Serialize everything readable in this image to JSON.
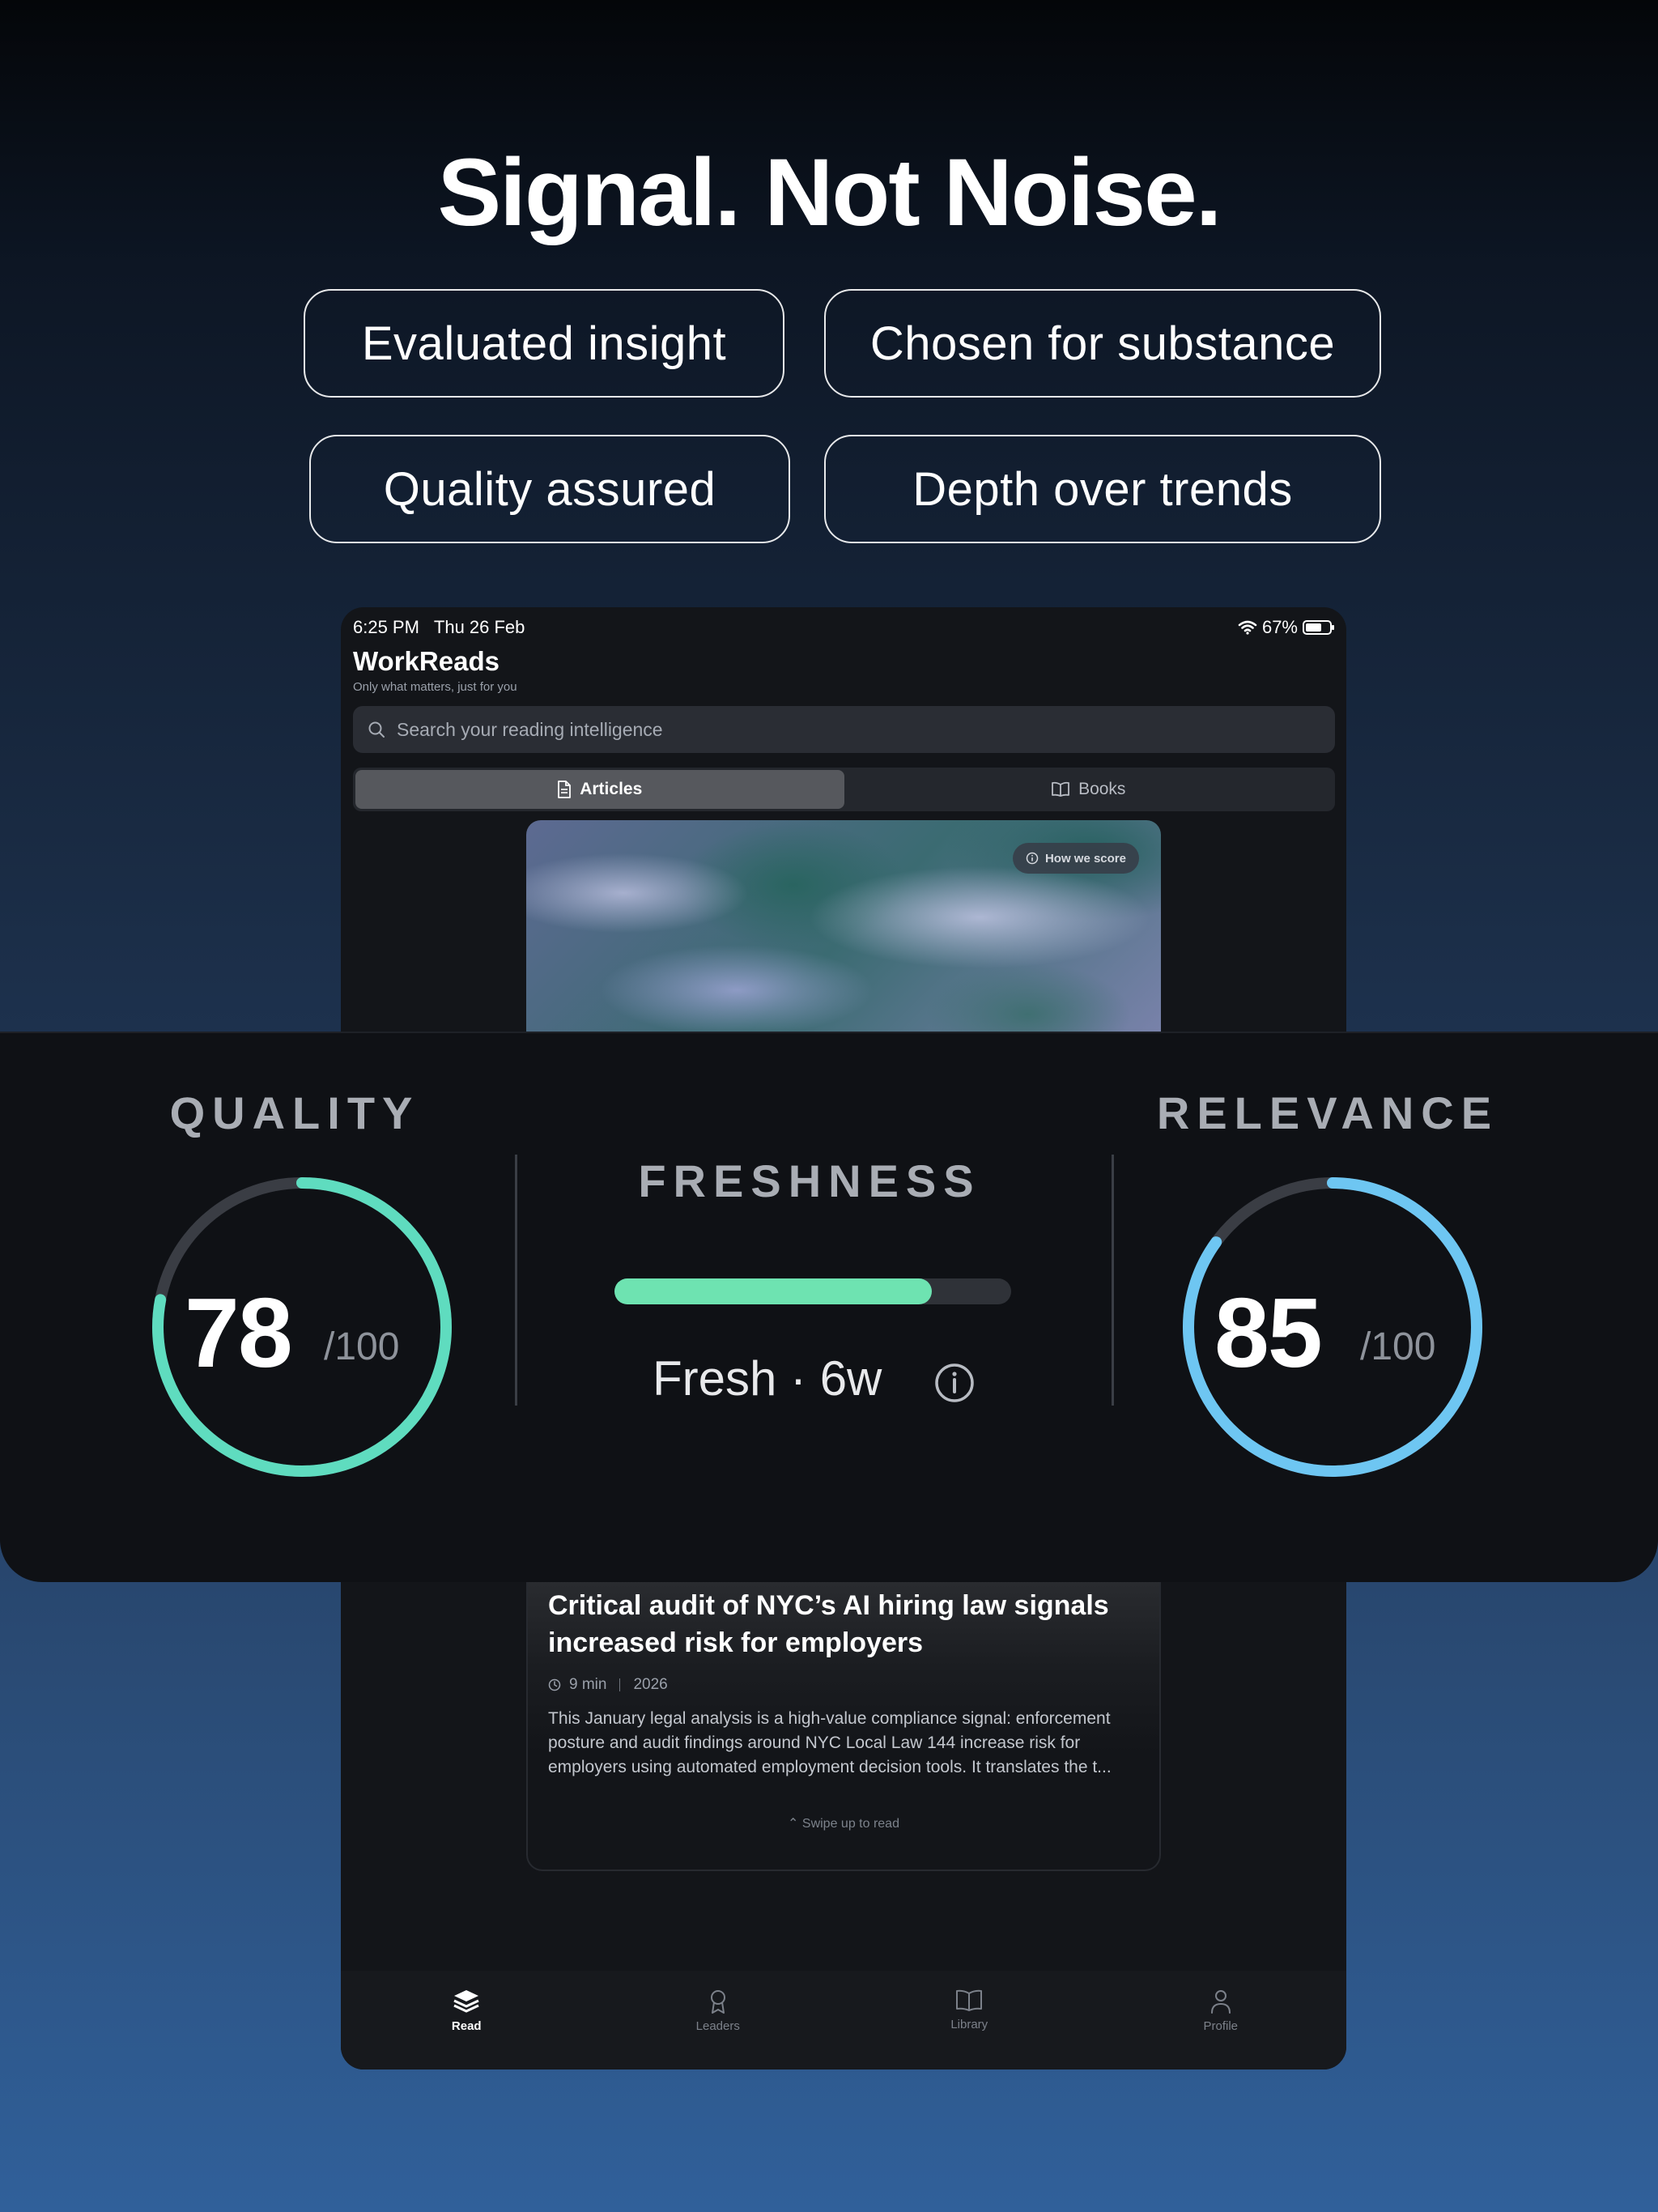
{
  "hero": {
    "headline": "Signal. Not Noise.",
    "pills": [
      "Evaluated insight",
      "Chosen for substance",
      "Quality assured",
      "Depth over trends"
    ]
  },
  "status_bar": {
    "time": "6:25 PM",
    "date": "Thu 26 Feb",
    "battery": "67%"
  },
  "app": {
    "title": "WorkReads",
    "subtitle": "Only what matters, just for you",
    "search_placeholder": "Search your reading intelligence",
    "tabs": [
      {
        "label": "Articles",
        "icon": "document-icon",
        "active": true
      },
      {
        "label": "Books",
        "icon": "book-icon",
        "active": false
      }
    ],
    "how_we_score": "How we score"
  },
  "scores": {
    "quality": {
      "label": "QUALITY",
      "value": "78",
      "denominator": "/100",
      "fraction": 0.78,
      "color": "#5fdcbf"
    },
    "freshness": {
      "label": "FRESHNESS",
      "text": "Fresh · 6w",
      "fraction": 0.8,
      "color": "#6ee3b1"
    },
    "relevance": {
      "label": "RELEVANCE",
      "value": "85",
      "denominator": "/100",
      "fraction": 0.85,
      "color": "#6ec6f2"
    }
  },
  "article": {
    "title": "Critical audit of NYC’s AI hiring law signals increased risk for employers",
    "read_time": "9 min",
    "year": "2026",
    "description": "This January legal analysis is a high-value compliance signal: enforcement posture and audit findings around NYC Local Law 144 increase risk for employers using automated employment decision tools. It translates the t...",
    "swipe_hint": "Swipe up to read"
  },
  "tabbar": [
    {
      "label": "Read",
      "icon": "layers-icon",
      "active": true
    },
    {
      "label": "Leaders",
      "icon": "award-icon",
      "active": false
    },
    {
      "label": "Library",
      "icon": "open-book-icon",
      "active": false
    },
    {
      "label": "Profile",
      "icon": "person-icon",
      "active": false
    }
  ]
}
